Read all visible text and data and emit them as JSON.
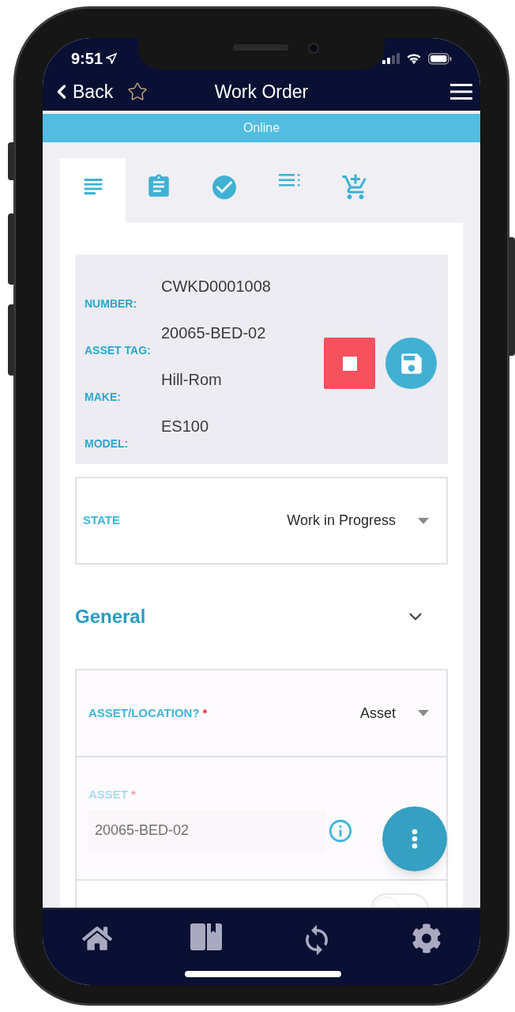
{
  "status_bar": {
    "time": "9:51"
  },
  "header": {
    "back": "Back",
    "title": "Work Order",
    "favorite": false
  },
  "banner": "Online",
  "tabs": [
    {
      "selected": true
    },
    {
      "selected": false
    },
    {
      "selected": false
    },
    {
      "selected": false
    },
    {
      "selected": false
    }
  ],
  "summary": [
    {
      "label": "NUMBER:",
      "value": "CWKD0001008"
    },
    {
      "label": "ASSET TAG:",
      "value": "20065-BED-02"
    },
    {
      "label": "MAKE:",
      "value": "Hill-Rom"
    },
    {
      "label": "MODEL:",
      "value": "ES100"
    }
  ],
  "state_field": {
    "label": "STATE",
    "value": "Work in Progress"
  },
  "section": {
    "title": "General",
    "expanded": true
  },
  "form": [
    {
      "kind": "select",
      "label": "ASSET/LOCATION?",
      "required_mark": "*",
      "disabled": false,
      "value": "Asset"
    },
    {
      "kind": "lookup",
      "label": "ASSET",
      "required_mark": "*",
      "disabled": true,
      "value": "20065-BED-02"
    },
    {
      "kind": "toggle",
      "on": false
    }
  ]
}
